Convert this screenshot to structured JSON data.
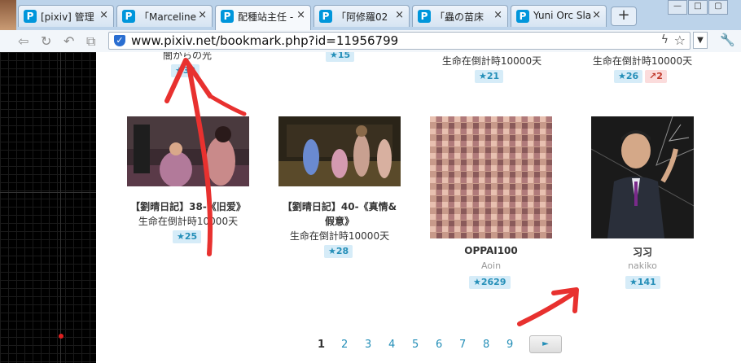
{
  "tabs": [
    {
      "icon": "P",
      "title": "[pixiv] 管理"
    },
    {
      "icon": "P",
      "title": "「Marceline"
    },
    {
      "icon": "P",
      "title": "配種站主任 -"
    },
    {
      "icon": "P",
      "title": "「阿修羅02"
    },
    {
      "icon": "P",
      "title": "「蟲の苗床"
    },
    {
      "icon": "P",
      "title": "Yuni Orc Sla"
    }
  ],
  "tab_close": "×",
  "new_tab": "+",
  "window_buttons": [
    "—",
    "□",
    "▢"
  ],
  "address_bar": {
    "url": "www.pixiv.net/bookmark.php?id=11956799"
  },
  "top_row": [
    {
      "caption": "闇からの光",
      "count": "39"
    },
    {
      "caption": "",
      "count": "15"
    },
    {
      "caption": "生命在倒計時10000天",
      "count": "21"
    },
    {
      "caption": "生命在倒計時10000天",
      "count": "26",
      "response": "2"
    }
  ],
  "works": [
    {
      "title": "【劉晴日記】38-《旧爱》",
      "user": "生命在倒計時10000天",
      "count": "25"
    },
    {
      "title_line1": "【劉晴日記】40-《真情&",
      "title_line2": "假意》",
      "user": "生命在倒計時10000天",
      "count": "28"
    },
    {
      "title": "OPPAI100",
      "user": "Aoin",
      "count": "2629"
    },
    {
      "title": "习习",
      "user": "nakiko",
      "count": "141"
    }
  ],
  "pagination": {
    "pages": [
      "1",
      "2",
      "3",
      "4",
      "5",
      "6",
      "7",
      "8",
      "9"
    ],
    "current": "1",
    "next": "►"
  },
  "colors": {
    "accent": "#258fb8",
    "badge_bg": "#d6ecf8",
    "annotation": "#e8312f"
  }
}
